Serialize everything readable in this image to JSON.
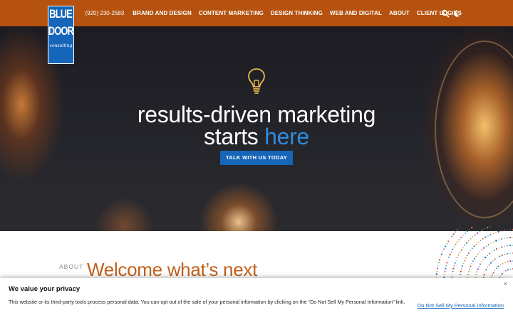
{
  "header": {
    "logo": {
      "line1": "BLUE",
      "line2": "DOOR",
      "sub": "consulting"
    },
    "phone": "(920) 230-2583",
    "nav": [
      {
        "label": "BRAND AND DESIGN"
      },
      {
        "label": "CONTENT MARKETING"
      },
      {
        "label": "DESIGN THINKING"
      },
      {
        "label": "WEB AND DIGITAL"
      },
      {
        "label": "ABOUT"
      },
      {
        "label": "CLIENT LOGINS"
      }
    ],
    "icons": [
      "search-icon",
      "dark-mode-moon-icon"
    ],
    "bg_color": "#b5520f"
  },
  "hero": {
    "icon": "lightbulb-icon",
    "line1": "results-driven marketing",
    "line2_plain": "starts ",
    "line2_accent": "here",
    "cta": "TALK WITH US TODAY",
    "accent_color": "#2f8be0",
    "button_color": "#1565b8"
  },
  "about": {
    "label": "ABOUT",
    "title": "Welcome what’s next",
    "title_color": "#c0601c"
  },
  "privacy": {
    "title": "We value your privacy",
    "text": "This website or its third-party tools process personal data. You can opt out of the sale of your personal information by clicking on the “Do Not Sell My Personal Information” link.",
    "link": "Do Not Sell My Personal Information",
    "close": "×"
  }
}
